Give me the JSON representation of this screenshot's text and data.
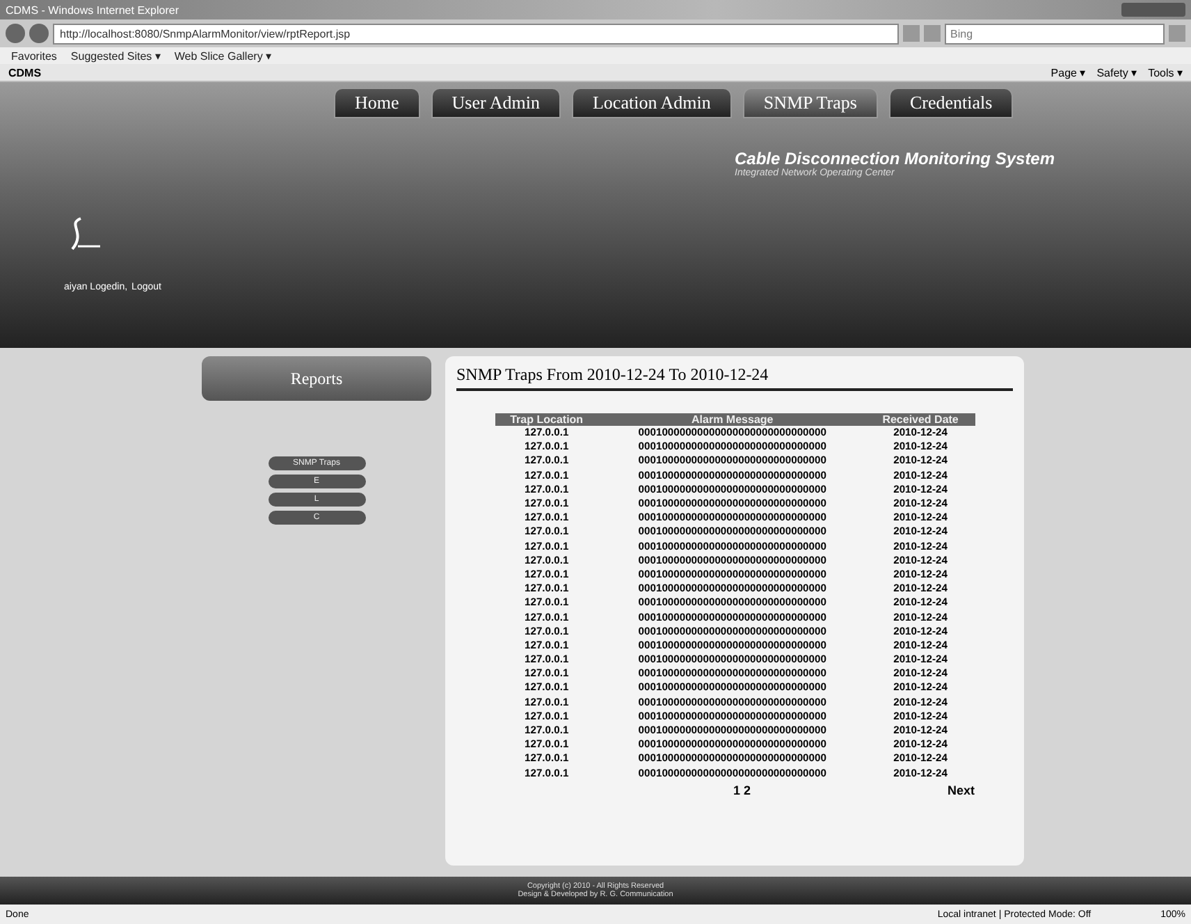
{
  "window": {
    "title": "CDMS - Windows Internet Explorer"
  },
  "address_bar": {
    "url": "http://localhost:8080/SnmpAlarmMonitor/view/rptReport.jsp",
    "search_placeholder": "Bing"
  },
  "favorites_bar": {
    "label": "Favorites",
    "links": [
      "Suggested Sites ▾",
      "Web Slice Gallery ▾"
    ]
  },
  "browser_tab": {
    "title": "CDMS"
  },
  "command_bar": [
    "Page ▾",
    "Safety ▾",
    "Tools ▾"
  ],
  "nav_tabs": [
    {
      "label": "Home",
      "selected": false
    },
    {
      "label": "User Admin",
      "selected": false
    },
    {
      "label": "Location Admin",
      "selected": false
    },
    {
      "label": "SNMP Traps",
      "selected": true
    },
    {
      "label": "Credentials",
      "selected": false
    }
  ],
  "banner": {
    "title": "Cable Disconnection Monitoring System",
    "subtitle": "Integrated Network Operating Center",
    "user": "aiyan Logedin,",
    "logout": "Logout"
  },
  "sidebar": {
    "title": "Reports",
    "buttons": [
      "SNMP Traps",
      "E",
      "L",
      "C"
    ]
  },
  "report": {
    "title": "SNMP Traps From 2010-12-24 To 2010-12-24",
    "columns": [
      "Trap Location",
      "Alarm Message",
      "Received Date"
    ],
    "rows": [
      [
        "127.0.0.1",
        "00010000000000000000000000000000",
        "2010-12-24"
      ],
      [
        "127.0.0.1",
        "00010000000000000000000000000000",
        "2010-12-24"
      ],
      [
        "127.0.0.1",
        "00010000000000000000000000000000",
        "2010-12-24"
      ],
      [
        "127.0.0.1",
        "00010000000000000000000000000000",
        "2010-12-24"
      ],
      [
        "127.0.0.1",
        "00010000000000000000000000000000",
        "2010-12-24"
      ],
      [
        "127.0.0.1",
        "00010000000000000000000000000000",
        "2010-12-24"
      ],
      [
        "127.0.0.1",
        "00010000000000000000000000000000",
        "2010-12-24"
      ],
      [
        "127.0.0.1",
        "00010000000000000000000000000000",
        "2010-12-24"
      ],
      [
        "127.0.0.1",
        "00010000000000000000000000000000",
        "2010-12-24"
      ],
      [
        "127.0.0.1",
        "00010000000000000000000000000000",
        "2010-12-24"
      ],
      [
        "127.0.0.1",
        "00010000000000000000000000000000",
        "2010-12-24"
      ],
      [
        "127.0.0.1",
        "00010000000000000000000000000000",
        "2010-12-24"
      ],
      [
        "127.0.0.1",
        "00010000000000000000000000000000",
        "2010-12-24"
      ],
      [
        "127.0.0.1",
        "00010000000000000000000000000000",
        "2010-12-24"
      ],
      [
        "127.0.0.1",
        "00010000000000000000000000000000",
        "2010-12-24"
      ],
      [
        "127.0.0.1",
        "00010000000000000000000000000000",
        "2010-12-24"
      ],
      [
        "127.0.0.1",
        "00010000000000000000000000000000",
        "2010-12-24"
      ],
      [
        "127.0.0.1",
        "00010000000000000000000000000000",
        "2010-12-24"
      ],
      [
        "127.0.0.1",
        "00010000000000000000000000000000",
        "2010-12-24"
      ],
      [
        "127.0.0.1",
        "00010000000000000000000000000000",
        "2010-12-24"
      ],
      [
        "127.0.0.1",
        "00010000000000000000000000000000",
        "2010-12-24"
      ],
      [
        "127.0.0.1",
        "00010000000000000000000000000000",
        "2010-12-24"
      ],
      [
        "127.0.0.1",
        "00010000000000000000000000000000",
        "2010-12-24"
      ],
      [
        "127.0.0.1",
        "00010000000000000000000000000000",
        "2010-12-24"
      ],
      [
        "127.0.0.1",
        "00010000000000000000000000000000",
        "2010-12-24"
      ]
    ],
    "pages": "1 2",
    "next": "Next"
  },
  "footer": [
    "Copyright (c) 2010 - All Rights Reserved",
    "Design & Developed by R. G. Communication"
  ],
  "status_bar": {
    "text": "Done",
    "zone": "Local intranet | Protected Mode: Off",
    "zoom": "100%"
  }
}
